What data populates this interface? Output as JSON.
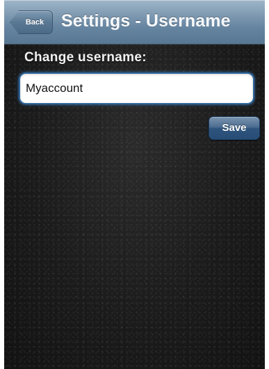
{
  "navbar": {
    "back_label": "Back",
    "title": "Settings - Username"
  },
  "form": {
    "label": "Change username:",
    "username_value": "Myaccount",
    "save_label": "Save"
  },
  "colors": {
    "navbar_blue": "#6584a0",
    "background_dark": "#1b1b1b",
    "input_focus_blue": "#2d6599",
    "save_button_blue": "#2e557f"
  }
}
